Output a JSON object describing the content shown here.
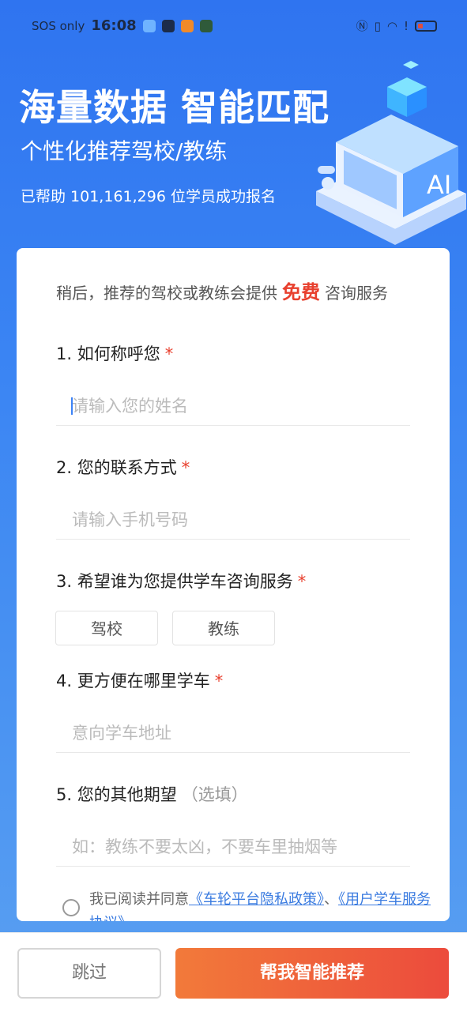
{
  "status_bar": {
    "carrier": "SOS only",
    "time": "16:08"
  },
  "hero": {
    "title": "海量数据 智能匹配",
    "subtitle": "个性化推荐驾校/教练",
    "helped_prefix": "已帮助 ",
    "helped_count": "101,161,296",
    "helped_suffix": " 位学员成功报名",
    "illustration_label": "AI"
  },
  "intro": {
    "text_before": "稍后，推荐的驾校或教练会提供",
    "free": "免费",
    "text_after": "咨询服务"
  },
  "questions": [
    {
      "label": "1. 如何称呼您",
      "required": "*",
      "placeholder": "请输入您的姓名"
    },
    {
      "label": "2. 您的联系方式",
      "required": "*",
      "placeholder": "请输入手机号码"
    },
    {
      "label": "3. 希望谁为您提供学车咨询服务",
      "required": "*",
      "options": [
        "驾校",
        "教练"
      ]
    },
    {
      "label": "4. 更方便在哪里学车",
      "required": "*",
      "placeholder": "意向学车地址"
    },
    {
      "label": "5. 您的其他期望",
      "optional": "（选填）",
      "placeholder": "如：教练不要太凶，不要车里抽烟等"
    }
  ],
  "agreement": {
    "prefix": "我已阅读并同意",
    "link1": "《车轮平台隐私政策》",
    "sep": "、",
    "link2": "《用户学车服务协议》"
  },
  "buttons": {
    "skip": "跳过",
    "recommend": "帮我智能推荐"
  },
  "colors": {
    "accent_red": "#e8402e",
    "brand_blue": "#3a84f3",
    "link": "#3a7be0"
  }
}
